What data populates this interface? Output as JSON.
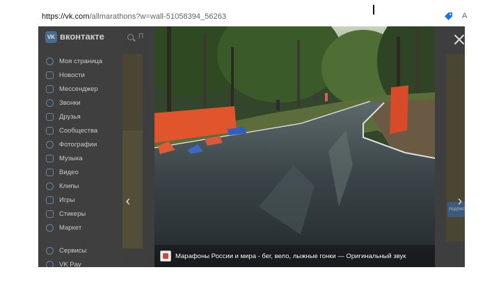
{
  "browser": {
    "url_host": "https://vk.com",
    "url_rest": "/allmarathons?w=wall-51058394_56263",
    "edge_char": "A"
  },
  "brand": {
    "logo_text": "VK",
    "name": "вконтакте"
  },
  "search": {
    "partial_char": "П"
  },
  "sidebar": {
    "items": [
      {
        "label": "Моя страница",
        "icon": "user-circle-icon"
      },
      {
        "label": "Новости",
        "icon": "news-icon"
      },
      {
        "label": "Мессенджер",
        "icon": "message-icon"
      },
      {
        "label": "Звонки",
        "icon": "phone-icon"
      },
      {
        "label": "Друзья",
        "icon": "friends-icon"
      },
      {
        "label": "Сообщества",
        "icon": "communities-icon"
      },
      {
        "label": "Фотографии",
        "icon": "photo-icon"
      },
      {
        "label": "Музыка",
        "icon": "music-icon"
      },
      {
        "label": "Видео",
        "icon": "video-icon"
      },
      {
        "label": "Клипы",
        "icon": "clips-icon"
      },
      {
        "label": "Игры",
        "icon": "games-icon"
      },
      {
        "label": "Стикеры",
        "icon": "stickers-icon"
      },
      {
        "label": "Маркет",
        "icon": "market-icon"
      }
    ],
    "extra_items": [
      {
        "label": "Сервисы",
        "icon": "services-icon"
      },
      {
        "label": "VK Pay",
        "icon": "vkpay-icon"
      }
    ]
  },
  "right_feed": {
    "partial_text": "подпис"
  },
  "video": {
    "caption": "Марафоны России и мира - бег, вело, лыжные гонки — Оригинальный звук"
  },
  "colors": {
    "overlay": "#3e3e3e",
    "accent": "#4a6a8e",
    "caption_text": "#ffffff"
  }
}
